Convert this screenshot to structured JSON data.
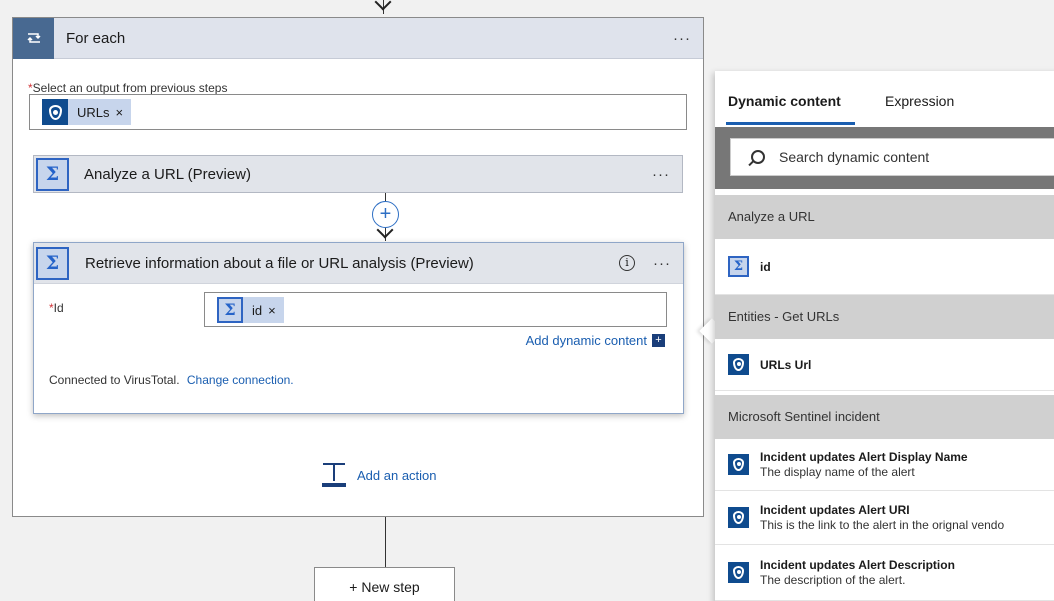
{
  "foreach": {
    "title": "For each",
    "more": "···",
    "select_label": "Select an output from previous steps",
    "required_mark": "*",
    "token": {
      "label": "URLs",
      "remove": "×"
    }
  },
  "analyze_step": {
    "title": "Analyze a URL",
    "suffix": "(Preview)",
    "more": "···"
  },
  "insert_step": {
    "label": "+"
  },
  "retrieve_step": {
    "title": "Retrieve information about a file or URL analysis",
    "suffix": "(Preview)",
    "more": "···",
    "info": "i",
    "id_label": "Id",
    "required_mark": "*",
    "token": {
      "label": "id",
      "remove": "×"
    },
    "add_dynamic": "Add dynamic content",
    "add_dynamic_icon": "+",
    "connected_text": "Connected to VirusTotal.",
    "change_connection": "Change connection."
  },
  "add_action": {
    "label": "Add an action"
  },
  "new_step": {
    "label": "+ New step"
  },
  "panel": {
    "tabs": [
      {
        "label": "Dynamic content",
        "active": true
      },
      {
        "label": "Expression",
        "active": false
      }
    ],
    "search_placeholder": "Search dynamic content",
    "sections": [
      {
        "title": "Analyze a URL"
      },
      {
        "title": "Entities - Get URLs"
      },
      {
        "title": "Microsoft Sentinel incident"
      }
    ],
    "items": [
      {
        "title": "id",
        "description": ""
      },
      {
        "title": "URLs Url",
        "description": ""
      },
      {
        "title": "Incident updates Alert Display Name",
        "description": "The display name of the alert"
      },
      {
        "title": "Incident updates Alert URI",
        "description": "This is the link to the alert in the orignal vendo"
      },
      {
        "title": "Incident updates Alert Description",
        "description": "The description of the alert."
      }
    ]
  },
  "colors": {
    "accent": "#1a5eb0",
    "loop_icon": "#486991",
    "sentinel": "#0f4b8e"
  },
  "icons": [
    "loop-icon",
    "sentinel-shield-icon",
    "sigma-icon",
    "info-icon",
    "add-action-icon",
    "search-icon"
  ]
}
